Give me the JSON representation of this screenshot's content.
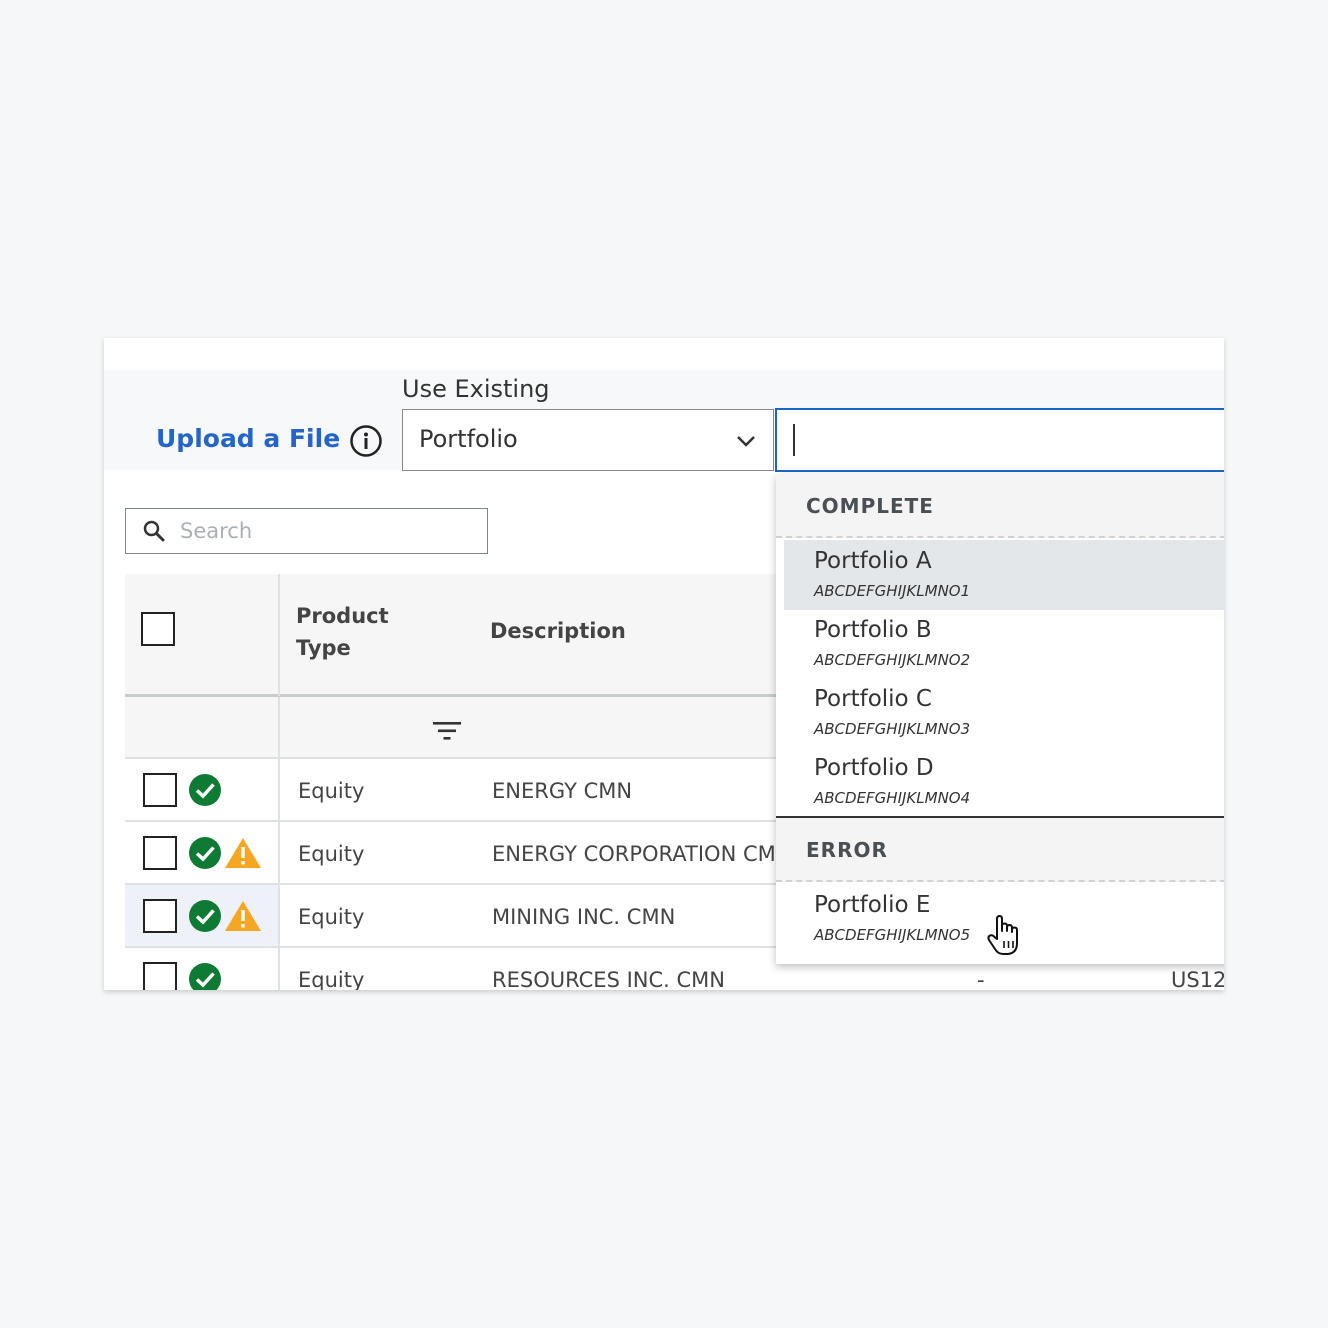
{
  "header": {
    "upload_label": "Upload a File",
    "use_existing_label": "Use Existing",
    "source_select": {
      "value": "Portfolio"
    },
    "portfolio_search": {
      "value": ""
    }
  },
  "search": {
    "placeholder": "Search"
  },
  "table": {
    "columns": {
      "product_type": "Product Type",
      "description": "Description"
    },
    "rows": [
      {
        "product_type": "Equity",
        "description": "ENERGY CMN",
        "ok": true,
        "warning": false,
        "dash": "",
        "id": ""
      },
      {
        "product_type": "Equity",
        "description": "ENERGY CORPORATION CMN",
        "ok": true,
        "warning": true,
        "dash": "",
        "id": ""
      },
      {
        "product_type": "Equity",
        "description": "MINING INC. CMN",
        "ok": true,
        "warning": true,
        "dash": "",
        "id": ""
      },
      {
        "product_type": "Equity",
        "description": "RESOURCES INC. CMN",
        "ok": true,
        "warning": false,
        "dash": "-",
        "id": "US12"
      }
    ]
  },
  "dropdown": {
    "groups": [
      {
        "label": "COMPLETE",
        "options": [
          {
            "name": "Portfolio A",
            "code": "ABCDEFGHIJKLMNO1",
            "hovered": true
          },
          {
            "name": "Portfolio B",
            "code": "ABCDEFGHIJKLMNO2"
          },
          {
            "name": "Portfolio C",
            "code": "ABCDEFGHIJKLMNO3"
          },
          {
            "name": "Portfolio D",
            "code": "ABCDEFGHIJKLMNO4"
          }
        ]
      },
      {
        "label": "ERROR",
        "options": [
          {
            "name": "Portfolio E",
            "code": "ABCDEFGHIJKLMNO5"
          }
        ]
      }
    ]
  },
  "colors": {
    "link": "#2365c9",
    "focus_border": "#1c63c9",
    "success": "#0e7a34",
    "warning": "#f5a623"
  },
  "icons": [
    "info-icon",
    "chevron-down-icon",
    "search-icon",
    "filter-icon",
    "check-circle-icon",
    "warning-icon",
    "hand-cursor-icon"
  ]
}
